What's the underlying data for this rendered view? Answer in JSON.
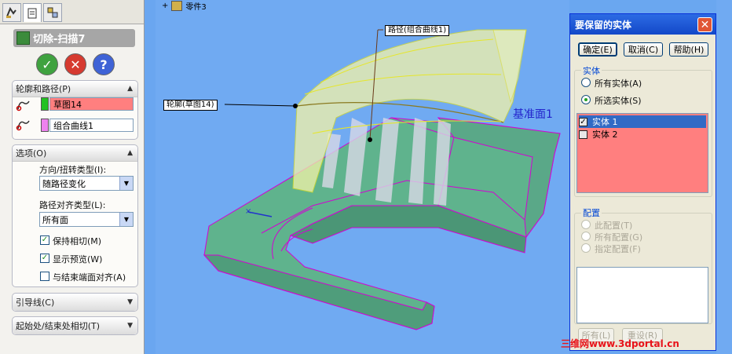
{
  "tabs": [
    {
      "name": "feature-manager-icon"
    },
    {
      "name": "property-manager-icon"
    },
    {
      "name": "configuration-manager-icon"
    }
  ],
  "feature": {
    "title": "切除-扫描7",
    "ok_symbol": "✓",
    "cancel_symbol": "✕",
    "help_symbol": "?"
  },
  "profile_path_group": {
    "header": "轮廓和路径(P)",
    "profile_value": "草图14",
    "path_value": "组合曲线1",
    "profile_color": "#ff7f7f",
    "path_color": "#ffffff"
  },
  "options_group": {
    "header": "选项(O)",
    "orient_label": "方向/扭转类型(I):",
    "orient_value": "随路径变化",
    "align_label": "路径对齐类型(L):",
    "align_value": "所有面",
    "keep_tangent": "保持相切(M)",
    "show_preview": "显示预览(W)",
    "align_end": "与结束端面对齐(A)"
  },
  "guide_group": {
    "header": "引导线(C)"
  },
  "tangency_group": {
    "header": "起始处/结束处相切(T)"
  },
  "viewport": {
    "part_name": "零件3",
    "path_callout": "路径(组合曲线1)",
    "profile_callout": "轮廓(草图14)",
    "plane_label": "基准面1"
  },
  "dialog": {
    "title": "要保留的实体",
    "ok": "确定(E)",
    "cancel": "取消(C)",
    "help": "帮助(H)",
    "bodies_group": "实体",
    "all_bodies": "所有实体(A)",
    "selected_bodies": "所选实体(S)",
    "bodies": [
      "实体 1",
      "实体 2"
    ],
    "config_group": "配置",
    "this_config": "此配置(T)",
    "all_config": "所有配置(G)",
    "spec_config": "指定配置(F)",
    "all_btn": "所有(L)",
    "reset_btn": "重设(R)"
  },
  "watermark": "三维网www.3dportal.cn",
  "colors": {
    "accent": "#0831d9",
    "list_bg": "#ff7f7f",
    "selected": "#316ac5",
    "model_green": "#5fb38d",
    "preview_yellow": "#f4f4a8",
    "edge_magenta": "#d400d4"
  }
}
